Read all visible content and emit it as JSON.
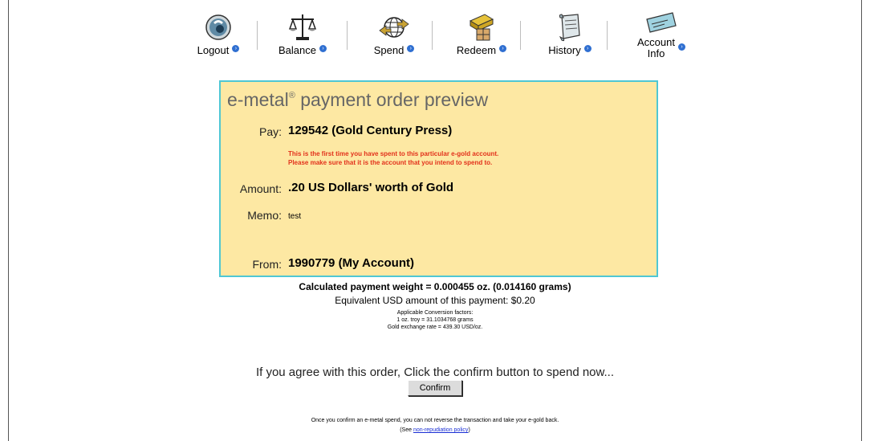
{
  "nav": {
    "items": [
      {
        "label": "Logout",
        "icon": "logout-icon"
      },
      {
        "label": "Balance",
        "icon": "balance-scale-icon"
      },
      {
        "label": "Spend",
        "icon": "spend-globe-icon"
      },
      {
        "label": "Redeem",
        "icon": "redeem-gold-bar-icon"
      },
      {
        "label": "History",
        "icon": "history-scroll-icon"
      },
      {
        "label_line1": "Account",
        "label_line2": "Info",
        "icon": "account-card-icon"
      }
    ]
  },
  "panel": {
    "title_prefix": "e-metal",
    "title_mark": "®",
    "title_suffix": " payment order preview",
    "pay_label": "Pay:",
    "pay_value": "129542 (Gold Century Press)",
    "warning_line1": "This is the first time you have spent to this particular e-gold account.",
    "warning_line2": "Please make sure that it is the account that you intend to spend to.",
    "amount_label": "Amount:",
    "amount_value": ".20 US Dollars' worth of Gold",
    "memo_label": "Memo:",
    "memo_value": "test",
    "from_label": "From:",
    "from_value": "1990779 (My Account)"
  },
  "summary": {
    "calc": "Calculated payment weight = 0.000455 oz. (0.014160 grams)",
    "equiv": "Equivalent USD amount of this payment: $0.20",
    "conv_title": "Applicable Conversion factors:",
    "conv_line1": "1 oz. troy = 31.1034768 grams",
    "conv_line2": "Gold exchange rate = 439.30 USD/oz."
  },
  "confirm": {
    "prompt": "If you agree with this order, Click the confirm button to spend now...",
    "button_label": "Confirm"
  },
  "footer": {
    "line1": "Once you confirm an e-metal spend, you can not reverse the transaction and take your e-gold back.",
    "line2_prefix": "(See ",
    "link_text": "non-repudiation policy",
    "line2_suffix": ")"
  },
  "colors": {
    "panel_bg": "#fde8a3",
    "panel_border": "#4fc7d3",
    "warning": "#e2311b",
    "link": "#1a2fd4"
  }
}
